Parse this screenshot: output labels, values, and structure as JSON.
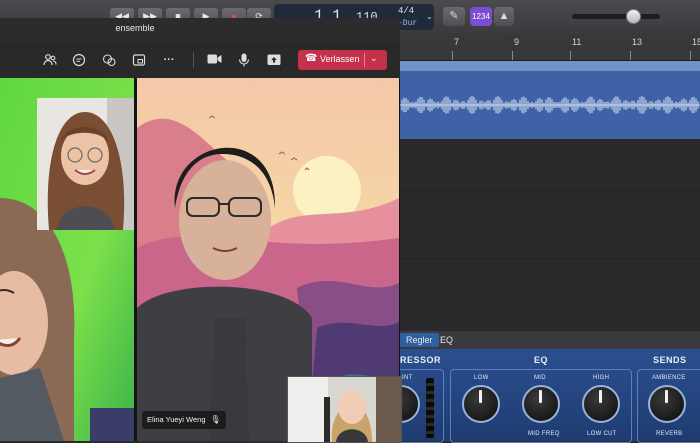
{
  "daw": {
    "lcd": {
      "bar": "1",
      "beat": "1",
      "tempo": "110",
      "signature": "4/4",
      "key": "-Dur"
    },
    "count_in_label": "1234",
    "ruler": [
      "7",
      "9",
      "11",
      "13",
      "15"
    ],
    "smart_controls": {
      "tabs": [
        "Regler",
        "EQ"
      ],
      "sections": [
        "RESSOR",
        "EQ",
        "SENDS"
      ],
      "knob_labels": [
        "LOW",
        "MID",
        "HIGH",
        "AMBIENCE",
        "MID FREQ",
        "LOW CUT",
        "REVERB"
      ],
      "partial_label": "INT"
    },
    "colors": {
      "region": "#3e62a5",
      "count_in": "#7c4dd2"
    }
  },
  "teams": {
    "window_title": "ensemble",
    "toolbar_icons": [
      "people-icon",
      "chat-icon",
      "reactions-icon",
      "rooms-icon",
      "more-icon",
      "camera-icon",
      "mic-icon",
      "share-icon"
    ],
    "leave_label": "Verlassen",
    "participant_name": "Elina Yueyi Weng",
    "leave_color": "#c4314b"
  }
}
